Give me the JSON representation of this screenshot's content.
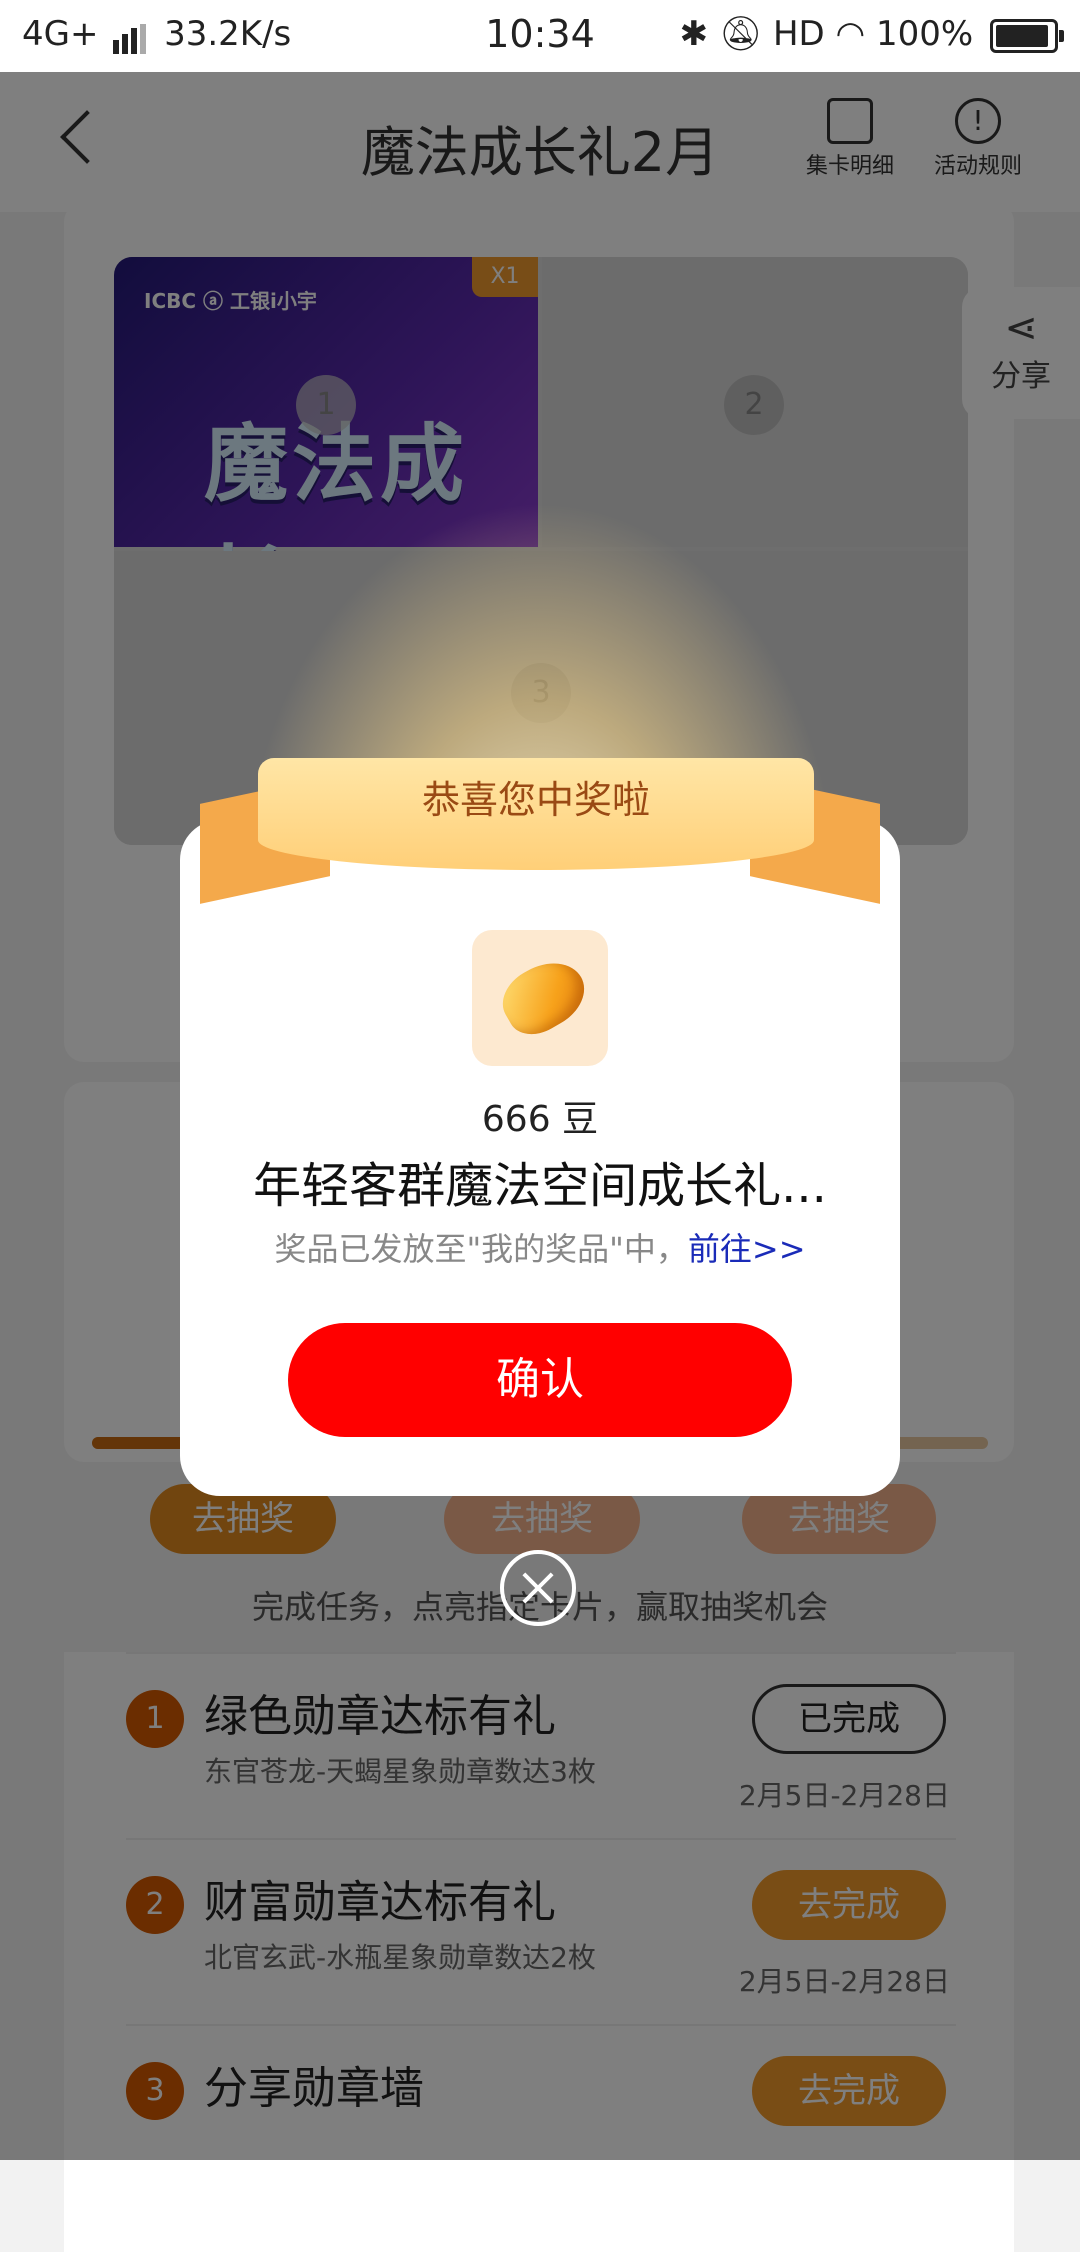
{
  "status_bar": {
    "network": "4G+",
    "speed": "33.2K/s",
    "time": "10:34",
    "hd": "HD",
    "battery": "100%"
  },
  "header": {
    "title": "魔法成长礼2月",
    "card_detail": "集卡明细",
    "rules": "活动规则",
    "share": "分享"
  },
  "puzzle": {
    "brand": "ICBC ⓐ 工银i小宇",
    "banner_text": "魔法成长",
    "count_badge": "X1",
    "pieces": [
      "1",
      "2",
      "3"
    ]
  },
  "draw_buttons": [
    "去抽奖",
    "去抽奖",
    "去抽奖"
  ],
  "hint": "完成任务，点亮指定卡片，赢取抽奖机会",
  "tasks": [
    {
      "num": "1",
      "name": "绿色勋章达标有礼",
      "desc": "东官苍龙-天蝎星象勋章数达3枚",
      "button": "已完成",
      "date": "2月5日-2月28日"
    },
    {
      "num": "2",
      "name": "财富勋章达标有礼",
      "desc": "北官玄武-水瓶星象勋章数达2枚",
      "button": "去完成",
      "date": "2月5日-2月28日"
    },
    {
      "num": "3",
      "name": "分享勋章墙",
      "desc": "",
      "button": "去完成",
      "date": ""
    }
  ],
  "modal": {
    "banner": "恭喜您中奖啦",
    "amount": "666 豆",
    "prize_name": "年轻客群魔法空间成长礼...",
    "note": "奖品已发放至\"我的奖品\"中，",
    "link": "前往>>",
    "confirm": "确认"
  },
  "colors": {
    "confirm": "#ff0000",
    "task_number": "#d65a00",
    "ribbon": "#ffcf78"
  }
}
